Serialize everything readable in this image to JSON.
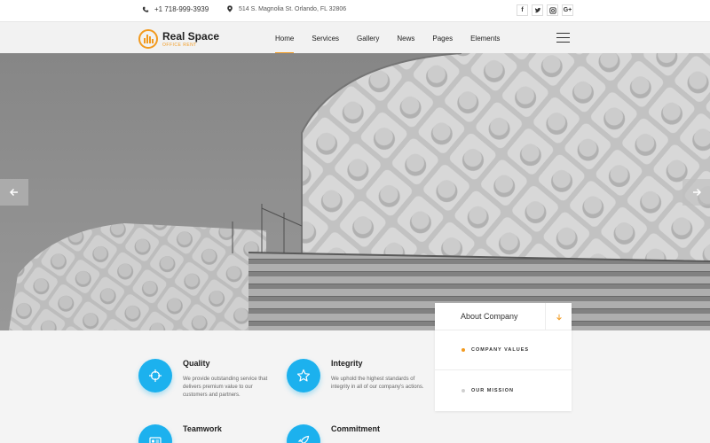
{
  "topbar": {
    "phone": "+1 718-999-3939",
    "address": "514 S. Magnolia St. Orlando, FL 32806",
    "socials": [
      {
        "label": "f",
        "icon": "facebook-icon"
      },
      {
        "label": "t",
        "icon": "twitter-icon"
      },
      {
        "label": "ig",
        "icon": "instagram-icon"
      },
      {
        "label": "G+",
        "icon": "google-plus-icon"
      }
    ]
  },
  "brand": {
    "name": "Real Space",
    "tagline": "Office Rent",
    "accent": "#f29a1f"
  },
  "nav": {
    "items": [
      {
        "label": "Home",
        "active": true
      },
      {
        "label": "Services"
      },
      {
        "label": "Gallery"
      },
      {
        "label": "News"
      },
      {
        "label": "Pages"
      },
      {
        "label": "Elements"
      }
    ]
  },
  "features": [
    {
      "title": "Quality",
      "desc": "We provide outstanding service that delivers premium value to our customers and partners.",
      "icon": "target-icon"
    },
    {
      "title": "Integrity",
      "desc": "We uphold the highest standards of integrity in all of our company's actions.",
      "icon": "star-icon"
    },
    {
      "title": "Teamwork",
      "desc": "",
      "icon": "id-card-icon"
    },
    {
      "title": "Commitment",
      "desc": "",
      "icon": "rocket-icon"
    }
  ],
  "about": {
    "title": "About Company",
    "items": [
      {
        "label": "Company Values",
        "active": true
      },
      {
        "label": "Our Mission",
        "active": false
      }
    ]
  },
  "colors": {
    "feature_icon_bg": "#1cb1ee",
    "accent": "#f29a1f"
  }
}
